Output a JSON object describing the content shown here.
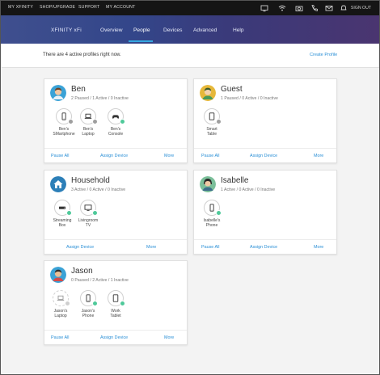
{
  "topbar": {
    "links": [
      "MY XFINITY",
      "SHOP/UPGRADE",
      "SUPPORT",
      "MY ACCOUNT"
    ],
    "signout": "SIGN OUT",
    "icons": [
      "tv-icon",
      "wifi-icon",
      "camera-icon",
      "phone-icon",
      "mail-icon",
      "bell-icon"
    ]
  },
  "header": {
    "brand": "XFINITY xFi",
    "nav": [
      "Overview",
      "People",
      "Devices",
      "Advanced",
      "Help"
    ],
    "active_nav": "People"
  },
  "notice": {
    "message": "There are 4 active profiles right now.",
    "create_label": "Create Profile"
  },
  "colors": {
    "accent": "#2a8fd6",
    "active_dot": "#4fc99a",
    "paused_dot": "#9e9e9e"
  },
  "profiles": [
    {
      "name": "Ben",
      "status": "2 Paused / 1 Active / 0 Inactive",
      "devices": [
        {
          "label1": "Ben's",
          "label2": "SMartphone",
          "icon": "smartphone-icon",
          "state": "paused"
        },
        {
          "label1": "Ben's",
          "label2": "Laptop",
          "icon": "laptop-icon",
          "state": "paused"
        },
        {
          "label1": "Ben's",
          "label2": "Console",
          "icon": "gamepad-icon",
          "state": "active"
        }
      ],
      "actions": [
        "Pause All",
        "Assign Device",
        "More"
      ]
    },
    {
      "name": "Guest",
      "status": "1 Paused / 0 Active / 0 Inactive",
      "devices": [
        {
          "label1": "Smart",
          "label2": "Table",
          "icon": "tablet-icon",
          "state": "paused"
        }
      ],
      "actions": [
        "Pause All",
        "Assign Device",
        "More"
      ]
    },
    {
      "name": "Household",
      "status": "3 Active / 0 Active / 0 Inactive",
      "devices": [
        {
          "label1": "Streaming",
          "label2": "Box",
          "icon": "streaming-box-icon",
          "state": "active"
        },
        {
          "label1": "Livingroom",
          "label2": "TV",
          "icon": "tv-icon",
          "state": "active"
        }
      ],
      "actions": [
        "Assign Device",
        "More"
      ]
    },
    {
      "name": "Isabelle",
      "status": "1 Active / 0 Active / 0 Inactive",
      "devices": [
        {
          "label1": "Isabelle's",
          "label2": "Phone",
          "icon": "smartphone-icon",
          "state": "active"
        }
      ],
      "actions": [
        "Pause All",
        "Assign Device",
        "More"
      ]
    },
    {
      "name": "Jason",
      "status": "0 Paused / 2 Active / 1 Inactive",
      "devices": [
        {
          "label1": "Jason's",
          "label2": "Laptop",
          "icon": "laptop-icon",
          "state": "paused"
        },
        {
          "label1": "Jason's",
          "label2": "Phone",
          "icon": "smartphone-icon",
          "state": "active"
        },
        {
          "label1": "Work",
          "label2": "Tablet",
          "icon": "tablet-icon",
          "state": "active"
        }
      ],
      "actions": [
        "Pause All",
        "Assign Device",
        "More"
      ]
    }
  ]
}
